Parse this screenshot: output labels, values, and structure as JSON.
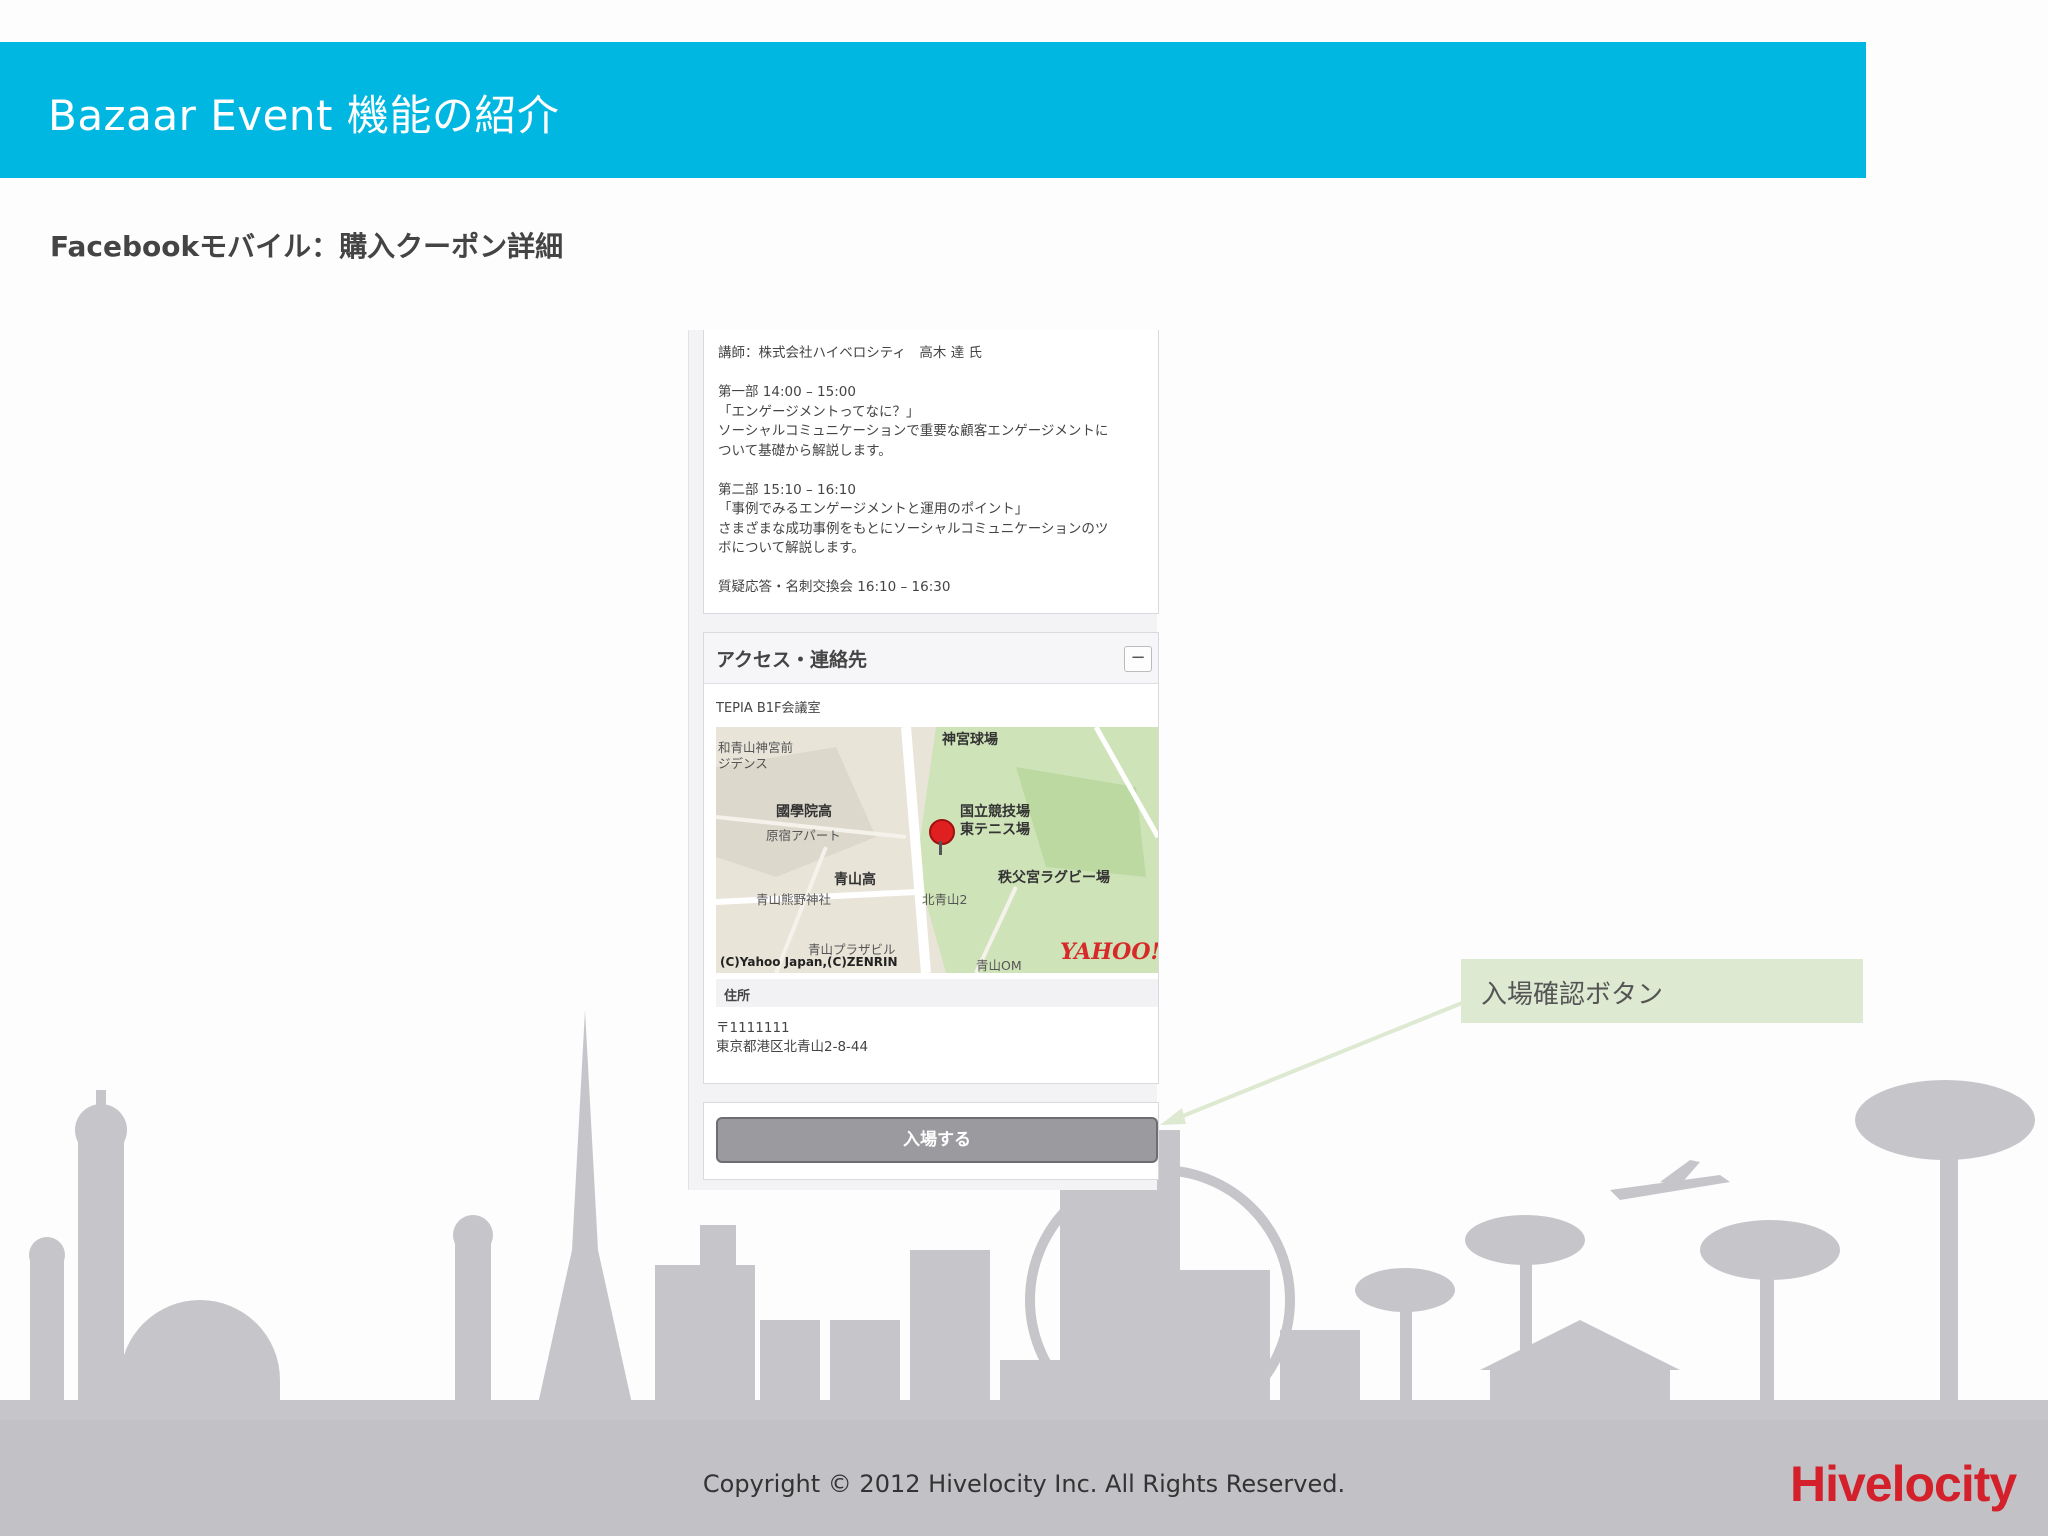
{
  "header": {
    "title": "Bazaar Event 機能の紹介"
  },
  "subtitle": "Facebookモバイル：購入クーポン詳細",
  "phone": {
    "description": "講師：株式会社ハイベロシティ　高木 達 氏\n\n第一部 14:00 – 15:00\n「エンゲージメントってなに？」\nソーシャルコミュニケーションで重要な顧客エンゲージメントに\nついて基礎から解説します。\n\n第二部 15:10 – 16:10\n「事例でみるエンゲージメントと運用のポイント」\nさまざまな成功事例をもとにソーシャルコミュニケーションのツ\nボについて解説します。\n\n質疑応答・名刺交換会 16:10 – 16:30",
    "access": {
      "title": "アクセス・連絡先",
      "collapse_symbol": "−",
      "venue": "TEPIA B1F会議室",
      "map": {
        "labels": [
          "神宮球場",
          "國學院高",
          "原宿アパート",
          "青山高",
          "国立競技場",
          "東テニス場",
          "秩父宮ラグビー場",
          "北青山2",
          "青山熊野神社",
          "青山プラザビル",
          "青山OM",
          "和青山神宮前",
          "ジデンス"
        ],
        "copyright": "(C)Yahoo Japan,(C)ZENRIN",
        "logo": "YAHOO!"
      },
      "address_label": "住所",
      "address": "〒1111111\n東京都港区北青山2-8-44"
    },
    "enter_button": "入場する"
  },
  "callout": {
    "label": "入場確認ボタン"
  },
  "footer": {
    "copyright": "Copyright © 2012 Hivelocity Inc. All Rights Reserved.",
    "brand": "Hivelocity"
  },
  "colors": {
    "header_bg": "#00b7e1",
    "callout_bg": "#dde9d1",
    "brand_red": "#d4202a",
    "skyline_gray": "#c2c2c6"
  }
}
